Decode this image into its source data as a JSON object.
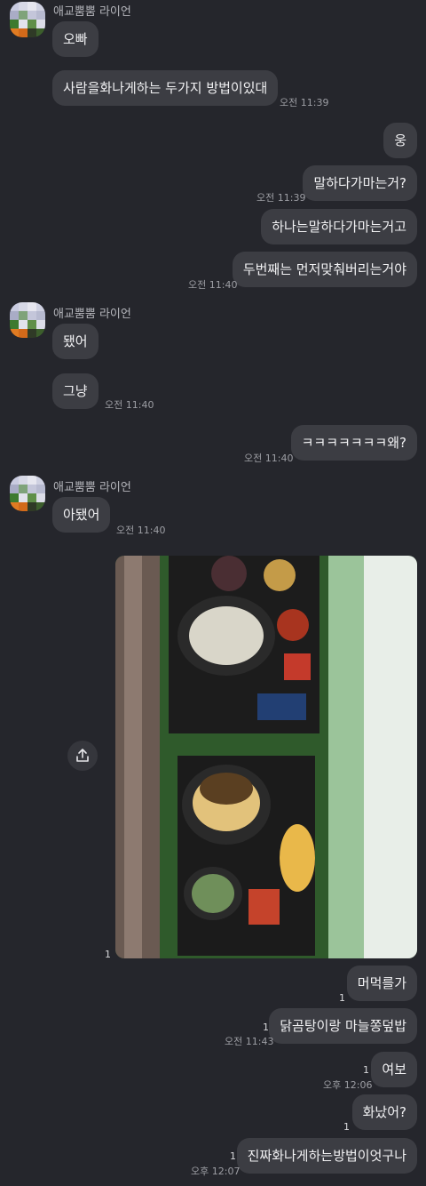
{
  "sender_name": "애교뿜뿜 라이언",
  "messages": [
    {
      "text": "오빠",
      "time": ""
    },
    {
      "text": "사람을화나게하는 두가지 방법이있대",
      "time": "오전 11:39"
    },
    {
      "text": "웅",
      "time": ""
    },
    {
      "text": "말하다가마는거?",
      "time": "오전 11:39"
    },
    {
      "text": "하나는말하다가마는거고",
      "time": ""
    },
    {
      "text": "두번째는 먼저맞춰버리는거야",
      "time": "오전 11:40"
    },
    {
      "text": "됐어",
      "time": ""
    },
    {
      "text": "그냥",
      "time": "오전 11:40"
    },
    {
      "text": "ㅋㅋㅋㅋㅋㅋㅋ왜?",
      "time": "오전 11:40"
    },
    {
      "text": "아됐어",
      "time": "오전 11:40"
    },
    {
      "text": "머먹를가",
      "unread": "1"
    },
    {
      "text": "닭곰탕이랑 마늘쫑덮밥",
      "unread": "1",
      "time": "오전 11:43"
    },
    {
      "text": "여보",
      "unread": "1",
      "time": "오후 12:06"
    },
    {
      "text": "화났어?",
      "unread": "1"
    },
    {
      "text": "진짜화나게하는방법이엇구나",
      "unread": "1",
      "time": "오후 12:07"
    }
  ],
  "photo": {
    "unread": "1",
    "description_icon": "share-icon"
  },
  "colors": {
    "background": "#25262c",
    "bubble": "#3c3d43"
  }
}
